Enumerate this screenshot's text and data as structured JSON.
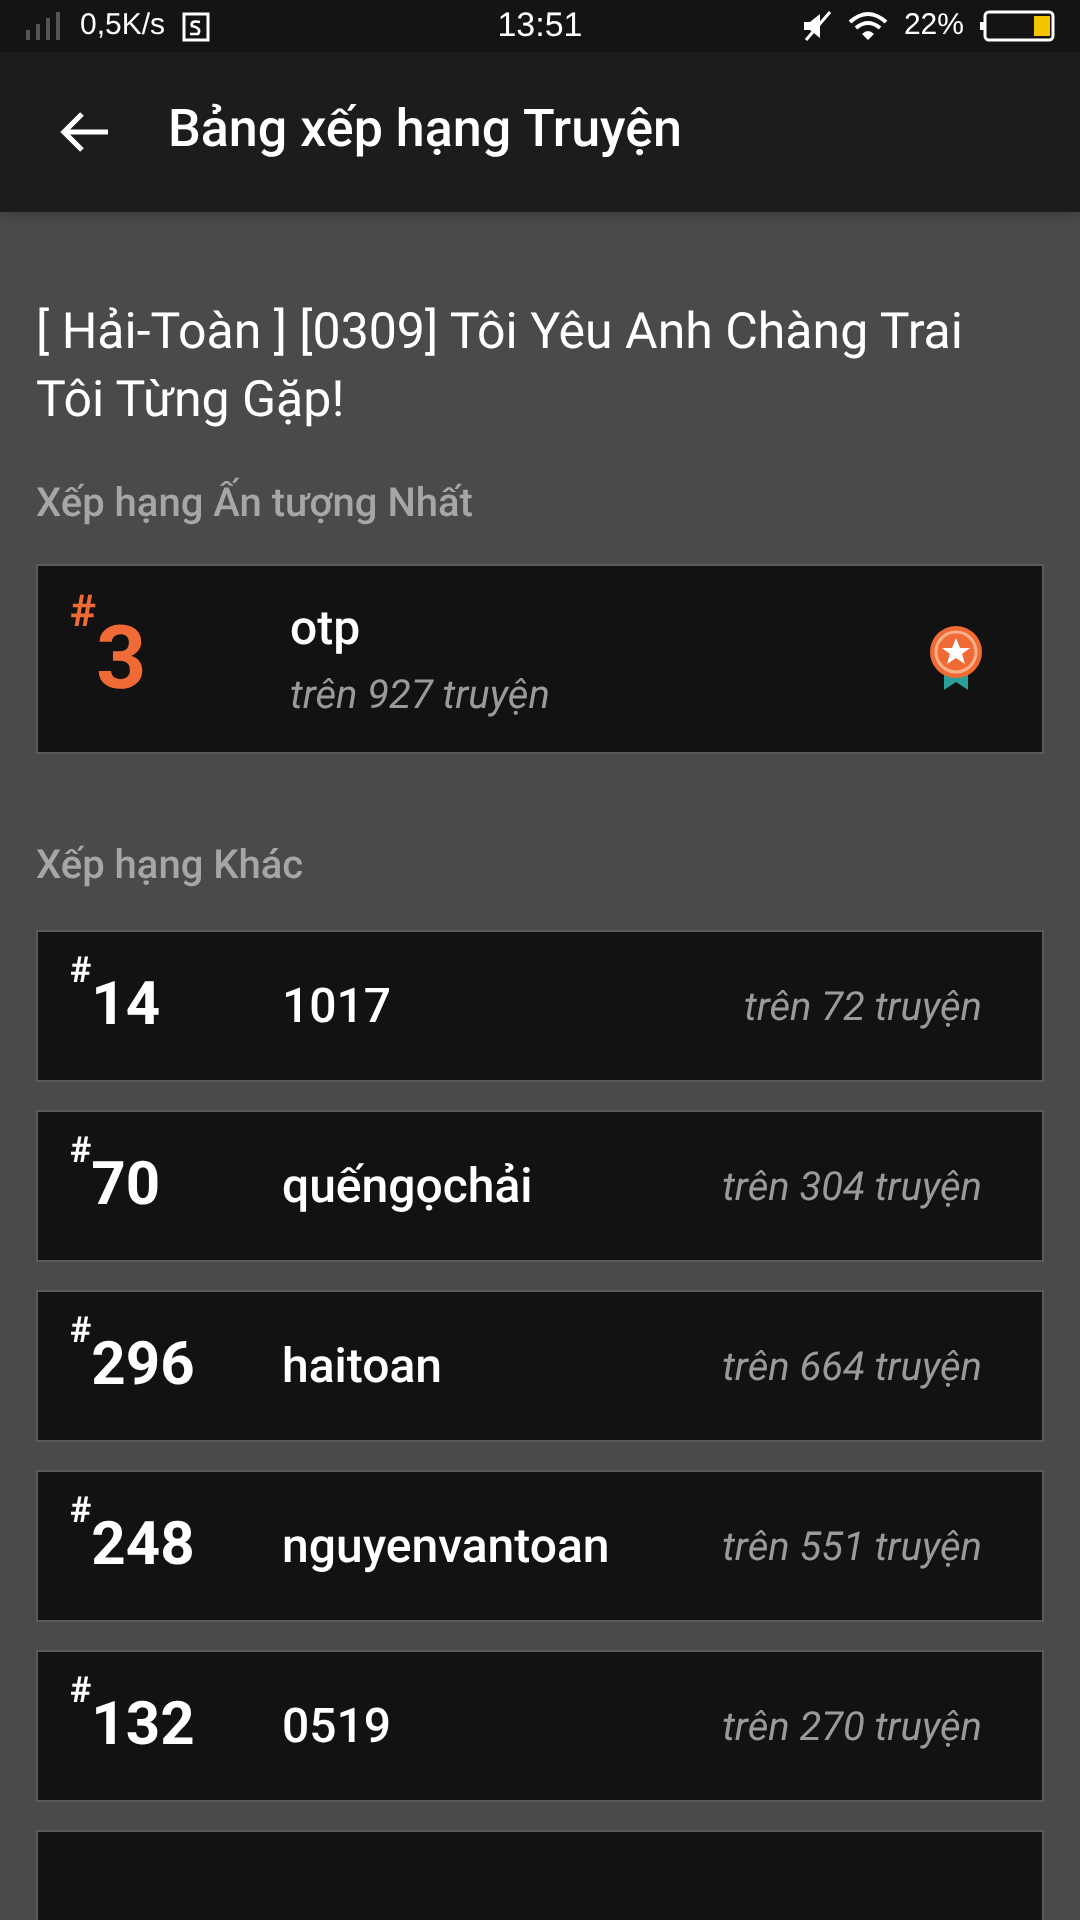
{
  "status_bar": {
    "speed": "0,5K/s",
    "time": "13:51",
    "battery": "22%"
  },
  "header": {
    "title": "Bảng xếp hạng Truyện"
  },
  "story_title": "[ Hải-Toàn ] [0309] Tôi Yêu Anh Chàng Trai Tôi Từng Gặp!",
  "top_section": {
    "label": "Xếp hạng Ấn tượng Nhất",
    "rank": "$^{#}$3",
    "tag": "otp",
    "count": "trên 927 truyện"
  },
  "other_section": {
    "label": "Xếp hạng Khác",
    "items": [
      {
        "rank": "$^{#}$14",
        "tag": "1017",
        "count": "trên 72 truyện"
      },
      {
        "rank": "$^{#}$70",
        "tag": "quếngọchải",
        "count": "trên 304 truyện"
      },
      {
        "rank": "$^{#}$296",
        "tag": "haitoan",
        "count": "trên 664 truyện"
      },
      {
        "rank": "$^{#}$248",
        "tag": "nguyenvantoan",
        "count": "trên 551 truyện"
      },
      {
        "rank": "$^{#}$132",
        "tag": "0519",
        "count": "trên 270 truyện"
      }
    ]
  }
}
